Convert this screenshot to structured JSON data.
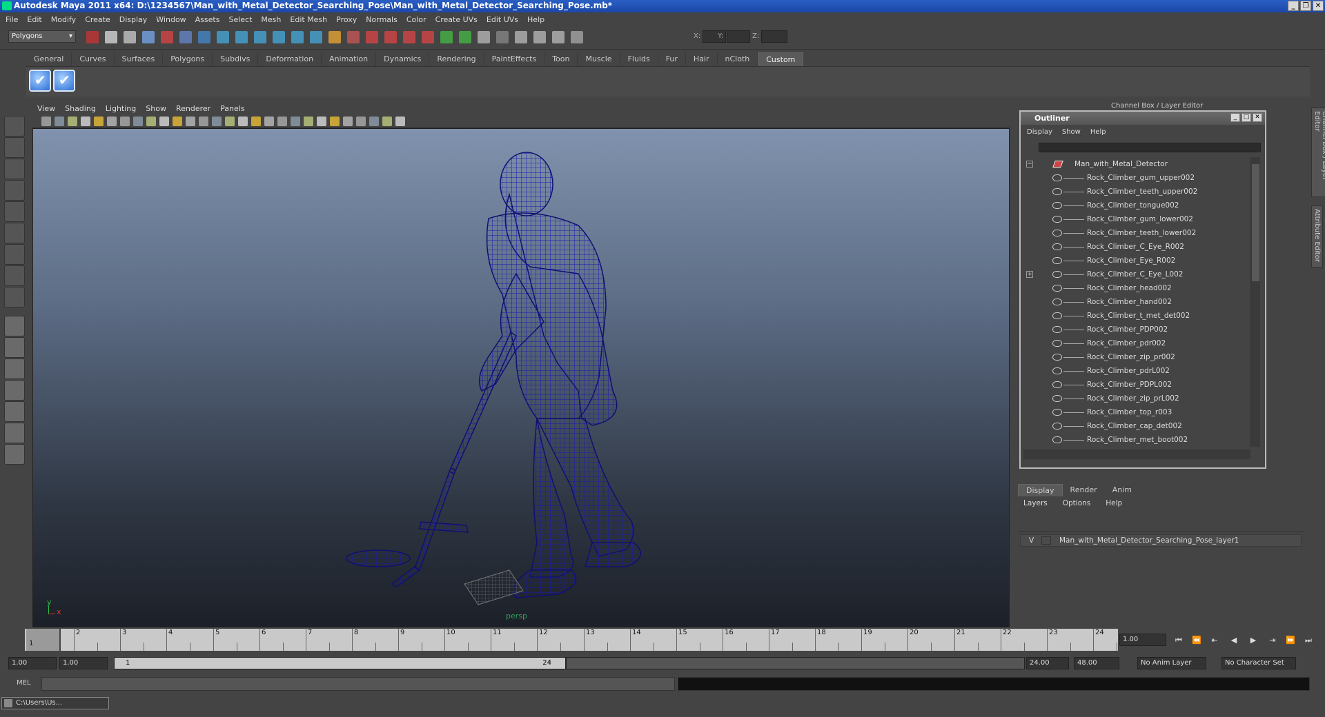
{
  "window": {
    "title": "Autodesk Maya 2011 x64: D:\\1234567\\Man_with_Metal_Detector_Searching_Pose\\Man_with_Metal_Detector_Searching_Pose.mb*"
  },
  "menubar": [
    "File",
    "Edit",
    "Modify",
    "Create",
    "Display",
    "Window",
    "Assets",
    "Select",
    "Mesh",
    "Edit Mesh",
    "Proxy",
    "Normals",
    "Color",
    "Create UVs",
    "Edit UVs",
    "Help"
  ],
  "status": {
    "mode": "Polygons",
    "x_label": "X:",
    "y_label": "Y:",
    "z_label": "Z:"
  },
  "shelf_tabs": [
    "General",
    "Curves",
    "Surfaces",
    "Polygons",
    "Subdivs",
    "Deformation",
    "Animation",
    "Dynamics",
    "Rendering",
    "PaintEffects",
    "Toon",
    "Muscle",
    "Fluids",
    "Fur",
    "Hair",
    "nCloth",
    "Custom"
  ],
  "shelf_active": "Custom",
  "panel_menu": [
    "View",
    "Shading",
    "Lighting",
    "Show",
    "Renderer",
    "Panels"
  ],
  "viewport": {
    "camera": "persp",
    "axis_y": "y",
    "axis_x": "x"
  },
  "channel_box_title": "Channel Box / Layer Editor",
  "side_tabs": [
    "Channel Box / Layer Editor",
    "Attribute Editor"
  ],
  "outliner": {
    "title": "Outliner",
    "menu": [
      "Display",
      "Show",
      "Help"
    ],
    "root": "Man_with_Metal_Detector",
    "items": [
      "Rock_Climber_gum_upper002",
      "Rock_Climber_teeth_upper002",
      "Rock_Climber_tongue002",
      "Rock_Climber_gum_lower002",
      "Rock_Climber_teeth_lower002",
      "Rock_Climber_C_Eye_R002",
      "Rock_Climber_Eye_R002",
      "Rock_Climber_C_Eye_L002",
      "Rock_Climber_head002",
      "Rock_Climber_hand002",
      "Rock_Climber_t_met_det002",
      "Rock_Climber_PDP002",
      "Rock_Climber_pdr002",
      "Rock_Climber_zip_pr002",
      "Rock_Climber_pdrL002",
      "Rock_Climber_PDPL002",
      "Rock_Climber_zip_prL002",
      "Rock_Climber_top_r003",
      "Rock_Climber_cap_det002",
      "Rock_Climber_met_boot002"
    ]
  },
  "layer_editor": {
    "tabs": [
      "Display",
      "Render",
      "Anim"
    ],
    "menu": [
      "Layers",
      "Options",
      "Help"
    ],
    "layer_visible": "V",
    "layer_name": "Man_with_Metal_Detector_Searching_Pose_layer1"
  },
  "timeline": {
    "ticks": [
      "1",
      "2",
      "3",
      "4",
      "5",
      "6",
      "7",
      "8",
      "9",
      "10",
      "11",
      "12",
      "13",
      "14",
      "15",
      "16",
      "17",
      "18",
      "19",
      "20",
      "21",
      "22",
      "23",
      "24"
    ],
    "current_frame_label": "1",
    "current_time": "1.00"
  },
  "range": {
    "start": "1.00",
    "anim_start": "1.00",
    "slider_start": "1",
    "slider_end": "24",
    "end": "24.00",
    "anim_end": "48.00",
    "anim_layer": "No Anim Layer",
    "character_set": "No Character Set"
  },
  "command": {
    "label": "MEL"
  },
  "taskbar": {
    "minimized_window": "C:\\Users\\Us..."
  }
}
